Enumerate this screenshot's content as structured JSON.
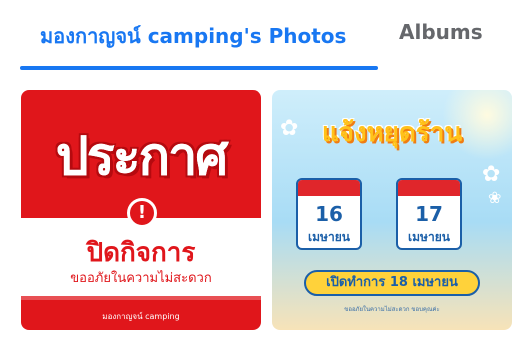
{
  "tabs": {
    "photos_label": "มองกาญจน์ camping's Photos",
    "albums_label": "Albums",
    "active_color": "#1877f2",
    "inactive_color": "#65676b"
  },
  "photos": [
    {
      "title": "ประกาศ",
      "line1": "ปิดกิจการ",
      "line2": "ขออภัยในความไม่สะดวก",
      "footer": "มองกาญจน์ camping",
      "alert_symbol": "!",
      "bg_color": "#e0161b"
    },
    {
      "title": "แจ้งหยุดร้าน",
      "calendar": [
        {
          "day": "16",
          "month": "เมษายน"
        },
        {
          "day": "17",
          "month": "เมษายน"
        }
      ],
      "open_text": "เปิดทำการ 18 เมษายน",
      "note": "ขออภัยในความไม่สะดวก ขอบคุณค่ะ"
    }
  ]
}
